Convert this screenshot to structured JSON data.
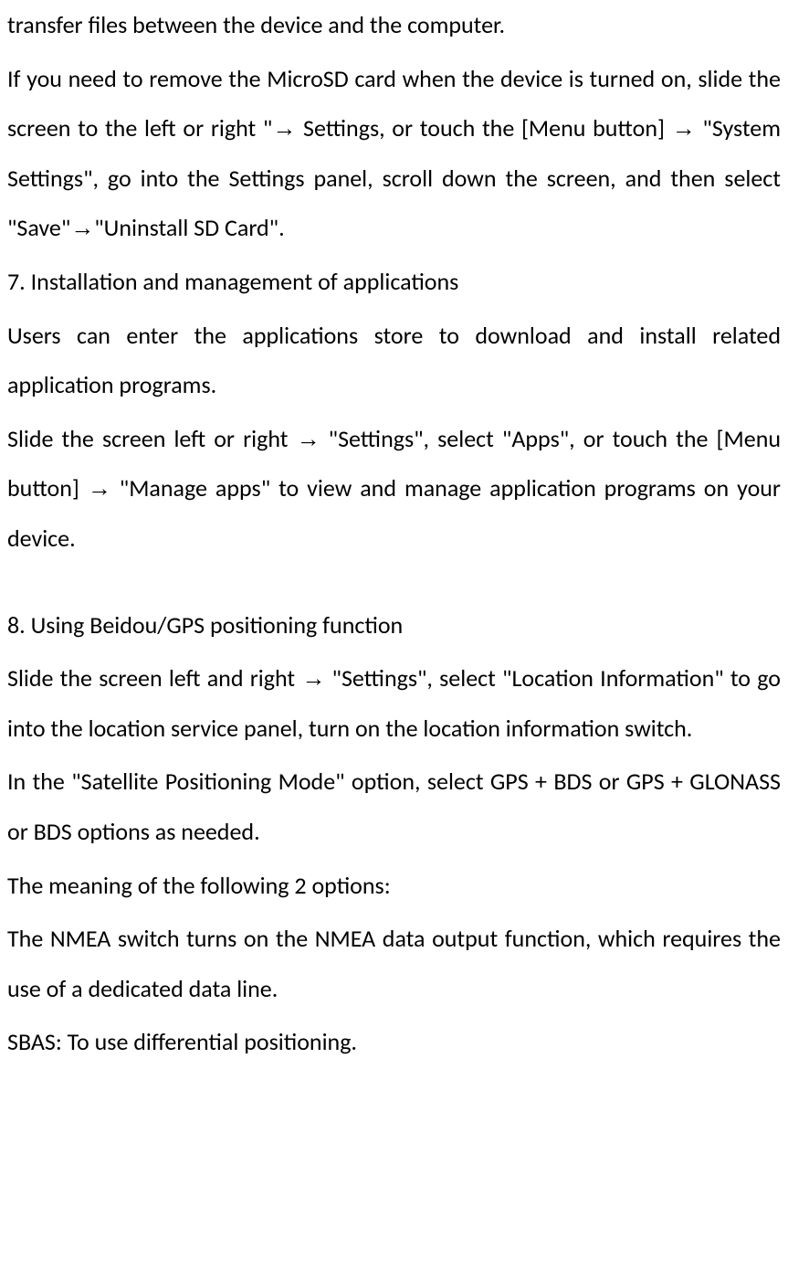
{
  "paragraphs": {
    "p1": "transfer files between the device and the computer.",
    "p2_part1": "If you need to remove the MicroSD card when the device is turned on, slide the screen to the left or right \"",
    "p2_arrow1": "→",
    "p2_part2": " Settings, or touch the [Menu button] ",
    "p2_arrow2": "→",
    "p2_part3": " \"System Settings\", go into the Settings panel, scroll down the screen, and then select \"Save\"",
    "p2_arrow3": "→",
    "p2_part4": "\"Uninstall SD Card\".",
    "h7": "7. Installation and management of applications",
    "p3": "Users can enter the applications store to download and install related application programs.",
    "p4_part1": "Slide the screen left or right ",
    "p4_arrow1": "→",
    "p4_part2": " \"Settings\", select \"Apps\", or touch the [Menu button] ",
    "p4_arrow2": "→",
    "p4_part3": " \"Manage apps\" to view and manage application programs on your device.",
    "h8": "8.    Using Beidou/GPS positioning function",
    "p5_part1": "Slide the screen left and right ",
    "p5_arrow1": "→",
    "p5_part2": " \"Settings\", select \"Location Information\" to go into the location service panel, turn on the location information switch.",
    "p6": "In the \"Satellite Positioning Mode\" option, select GPS + BDS or GPS + GLONASS or BDS options as needed.",
    "p7": "The meaning of the following 2 options:",
    "p8": "The NMEA switch turns on the NMEA data output function, which requires the use of a dedicated data line.",
    "p9": "SBAS: To use differential positioning."
  }
}
